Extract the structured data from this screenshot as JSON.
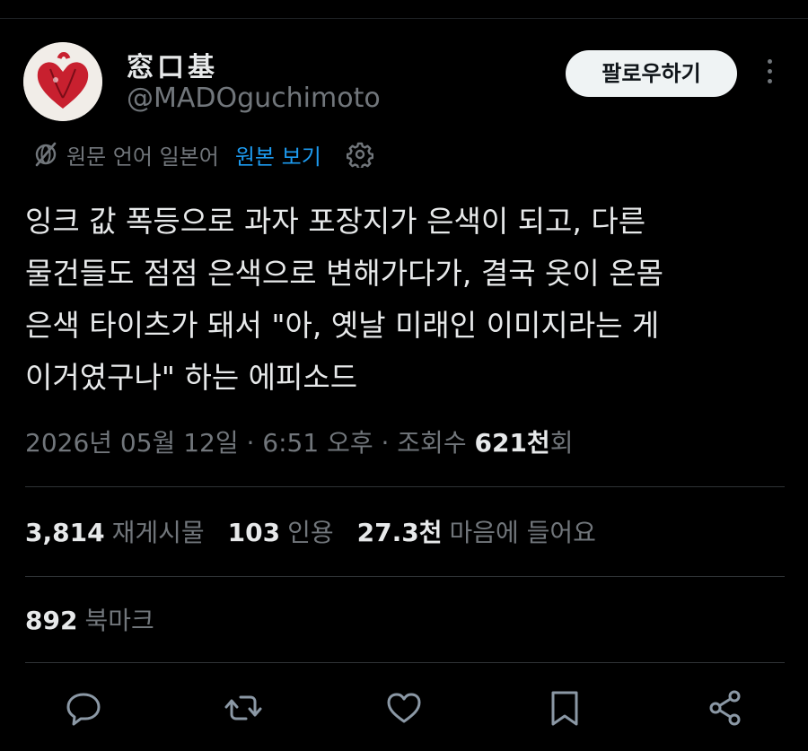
{
  "author": {
    "display_name": "窓口基",
    "handle": "@MADOguchimoto"
  },
  "header": {
    "follow_label": "팔로우하기"
  },
  "translation": {
    "source_text": "원문 언어 일본어",
    "view_original_label": "원본 보기"
  },
  "tweet": {
    "text": "잉크 값 폭등으로 과자 포장지가 은색이 되고, 다른\n물건들도 점점 은색으로 변해가다가, 결국 옷이 온몸\n은색 타이츠가 돼서 \"아, 옛날 미래인 이미지라는 게\n이거였구나\" 하는 에피소드"
  },
  "meta": {
    "timestamp": "2026년 05월 12일 · 6:51 오후 · 조회수 ",
    "views_count": "621천",
    "views_suffix": "회"
  },
  "stats": {
    "reposts": {
      "count": "3,814",
      "label": "재게시물"
    },
    "quotes": {
      "count": "103",
      "label": "인용"
    },
    "likes": {
      "count": "27.3천",
      "label": "마음에 들어요"
    },
    "bookmarks": {
      "count": "892",
      "label": "북마크"
    }
  },
  "icons": {
    "translate": "globe-slash-icon",
    "settings": "gear-icon",
    "more": "more-icon",
    "reply": "reply-icon",
    "repost": "repost-icon",
    "like": "heart-icon",
    "bookmark": "bookmark-icon",
    "share": "share-icon"
  },
  "colors": {
    "background": "#000000",
    "text_primary": "#e7e9ea",
    "text_secondary": "#71767b",
    "link": "#1d9bf0",
    "follow_button_bg": "#eff3f4"
  }
}
